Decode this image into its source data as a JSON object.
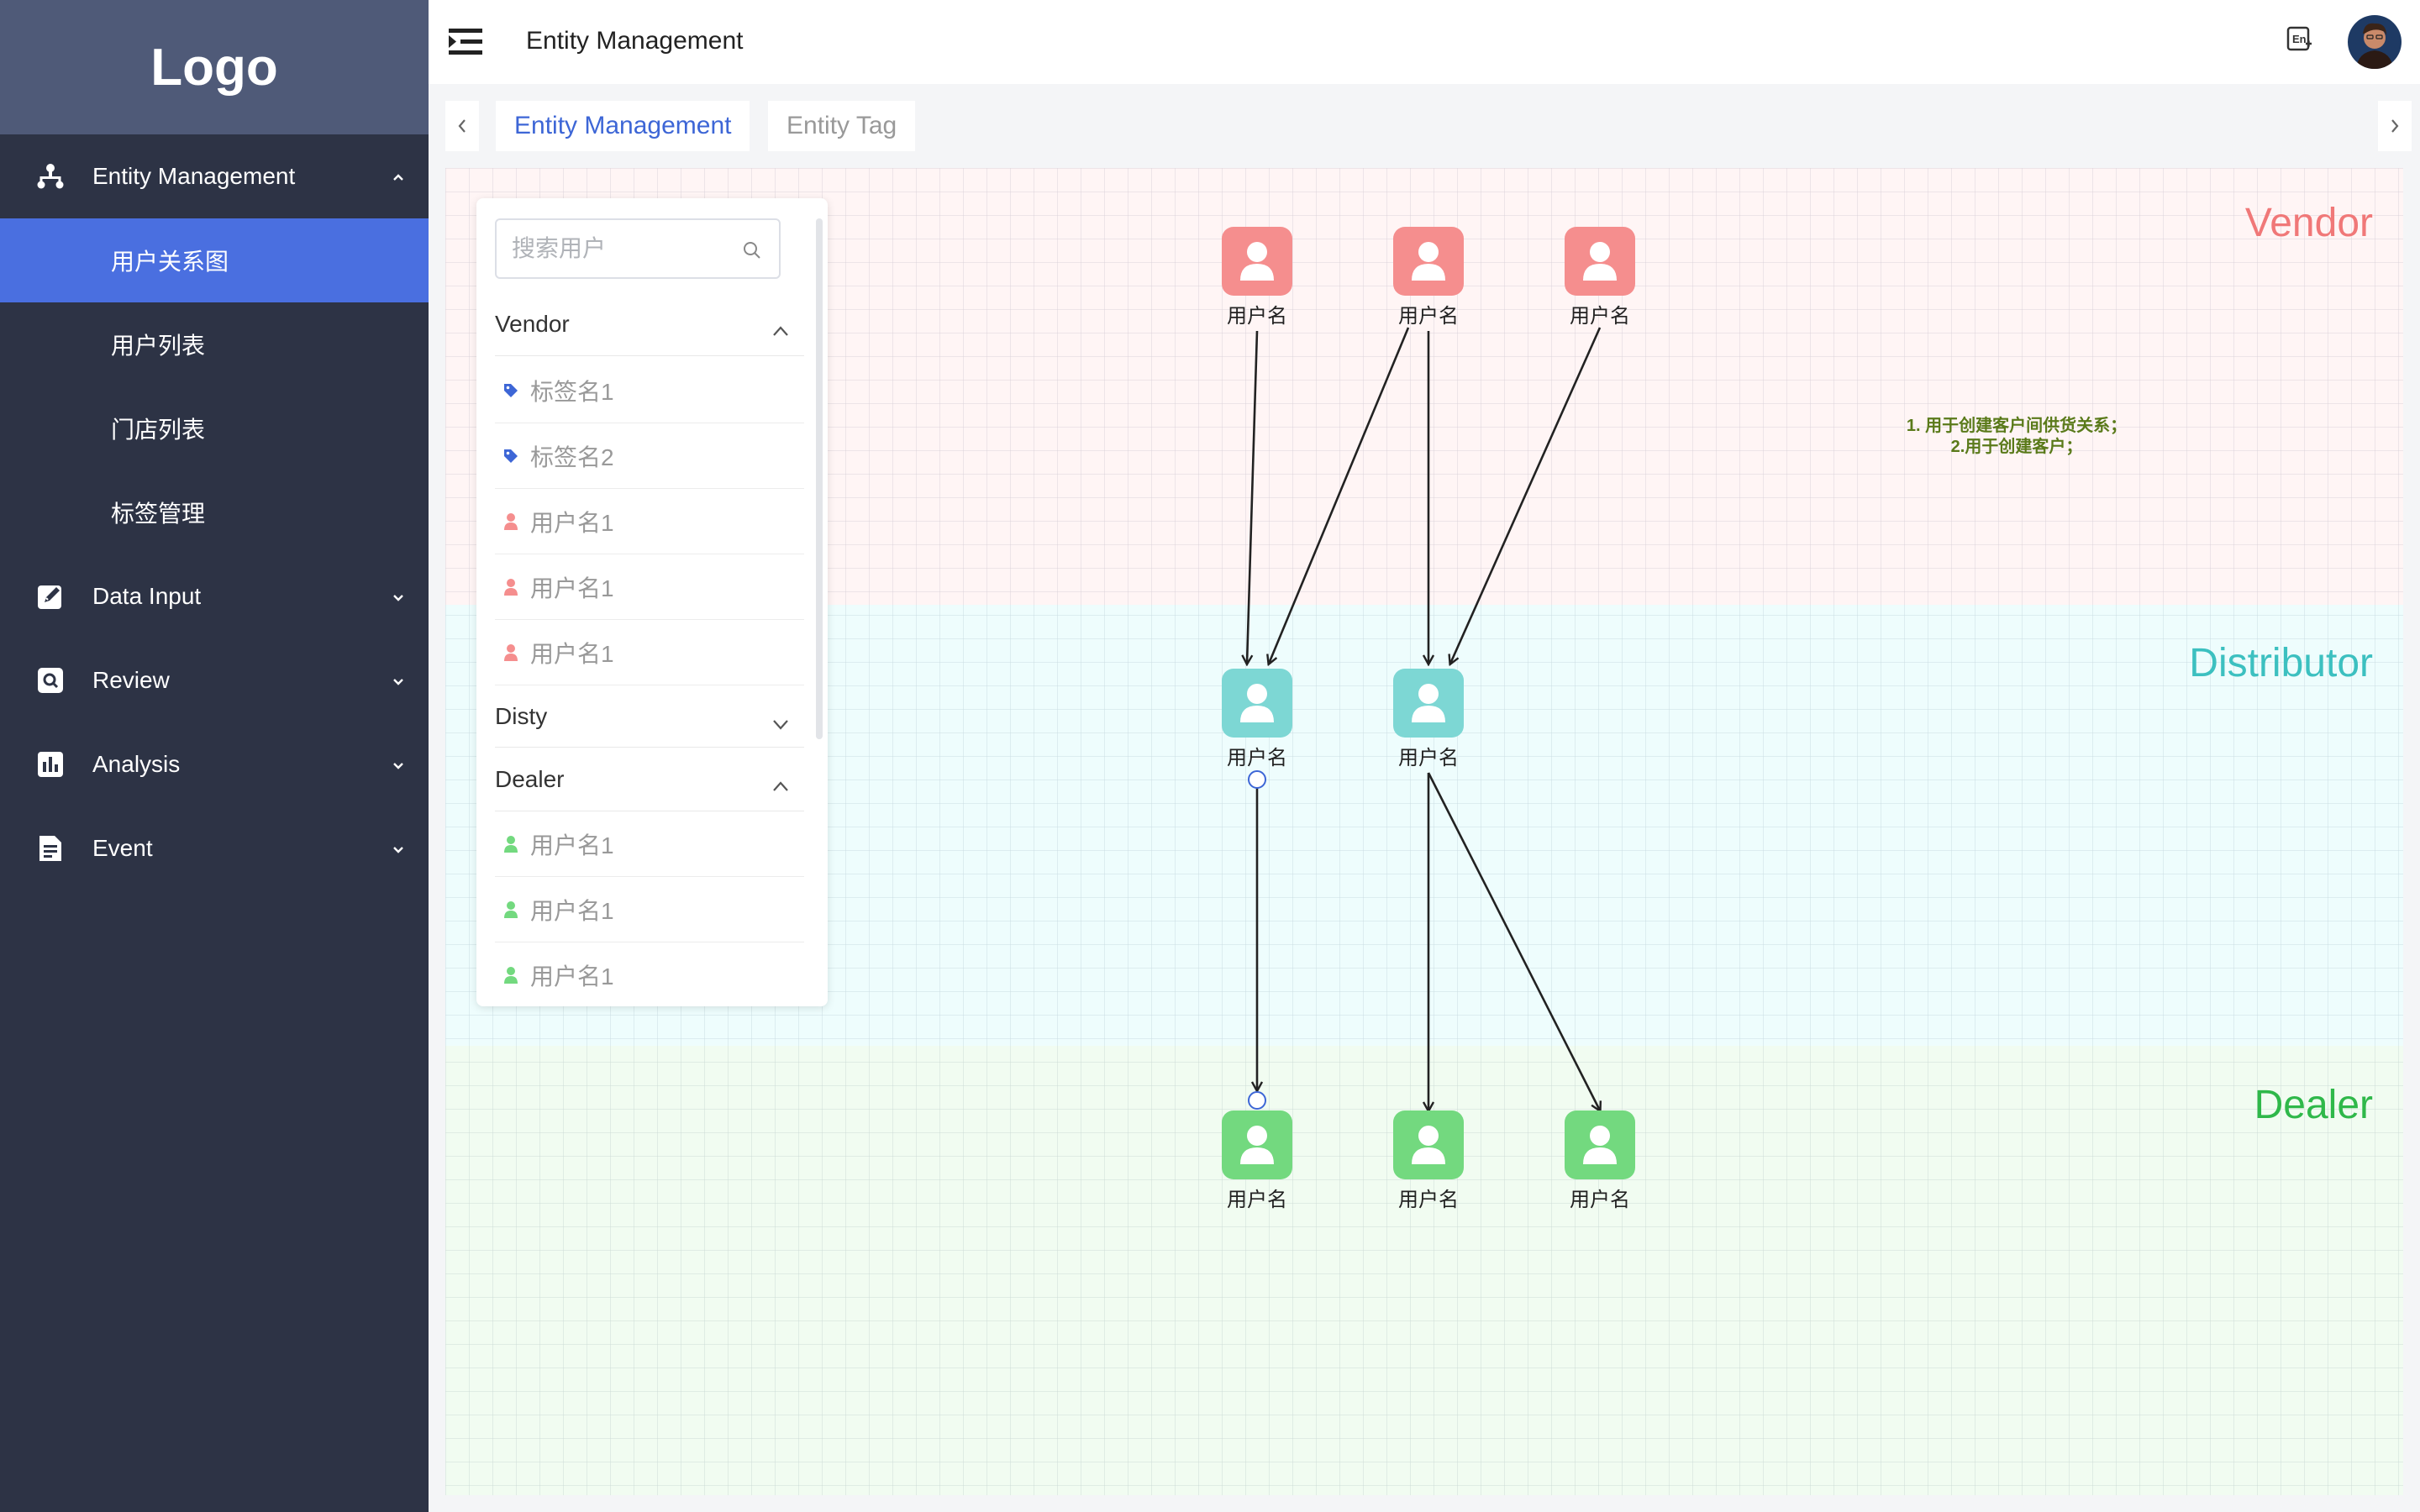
{
  "sidebar": {
    "logo": "Logo",
    "menu": [
      {
        "label": "Entity Management",
        "icon": "sitemap-icon",
        "expanded": true,
        "children": [
          {
            "label": "用户关系图",
            "active": true
          },
          {
            "label": "用户列表"
          },
          {
            "label": "门店列表"
          },
          {
            "label": "标签管理"
          }
        ]
      },
      {
        "label": "Data Input",
        "icon": "edit-icon"
      },
      {
        "label": "Review",
        "icon": "search-doc-icon"
      },
      {
        "label": "Analysis",
        "icon": "bar-chart-icon"
      },
      {
        "label": "Event",
        "icon": "document-icon"
      }
    ]
  },
  "header": {
    "title": "Entity Management",
    "lang_icon": "language-icon",
    "avatar": "user-avatar"
  },
  "tabs": [
    {
      "label": "Entity Management",
      "active": true
    },
    {
      "label": "Entity Tag",
      "active": false
    }
  ],
  "canvas": {
    "lanes": [
      {
        "label": "Vendor",
        "color": "#f07878"
      },
      {
        "label": "Distributor",
        "color": "#3cc0c0"
      },
      {
        "label": "Dealer",
        "color": "#2fb84a"
      }
    ],
    "note": [
      "1. 用于创建客户间供货关系；",
      "2.用于创建客户；"
    ],
    "node_label": "用户名",
    "nodes": {
      "vendor": [
        "用户名",
        "用户名",
        "用户名"
      ],
      "distributor": [
        "用户名",
        "用户名"
      ],
      "dealer": [
        "用户名",
        "用户名",
        "用户名"
      ]
    },
    "colors": {
      "vendor": "#f58e8e",
      "distributor": "#7dd7d4",
      "dealer": "#73d97f"
    }
  },
  "panel": {
    "search_placeholder": "搜索用户",
    "groups": [
      {
        "label": "Vendor",
        "expanded": true,
        "items": [
          {
            "label": "标签名1",
            "type": "tag"
          },
          {
            "label": "标签名2",
            "type": "tag"
          },
          {
            "label": "用户名1",
            "type": "vendor-user"
          },
          {
            "label": "用户名1",
            "type": "vendor-user"
          },
          {
            "label": "用户名1",
            "type": "vendor-user"
          }
        ]
      },
      {
        "label": "Disty",
        "expanded": false,
        "items": []
      },
      {
        "label": "Dealer",
        "expanded": true,
        "items": [
          {
            "label": "用户名1",
            "type": "dealer-user"
          },
          {
            "label": "用户名1",
            "type": "dealer-user"
          },
          {
            "label": "用户名1",
            "type": "dealer-user"
          }
        ]
      }
    ]
  }
}
